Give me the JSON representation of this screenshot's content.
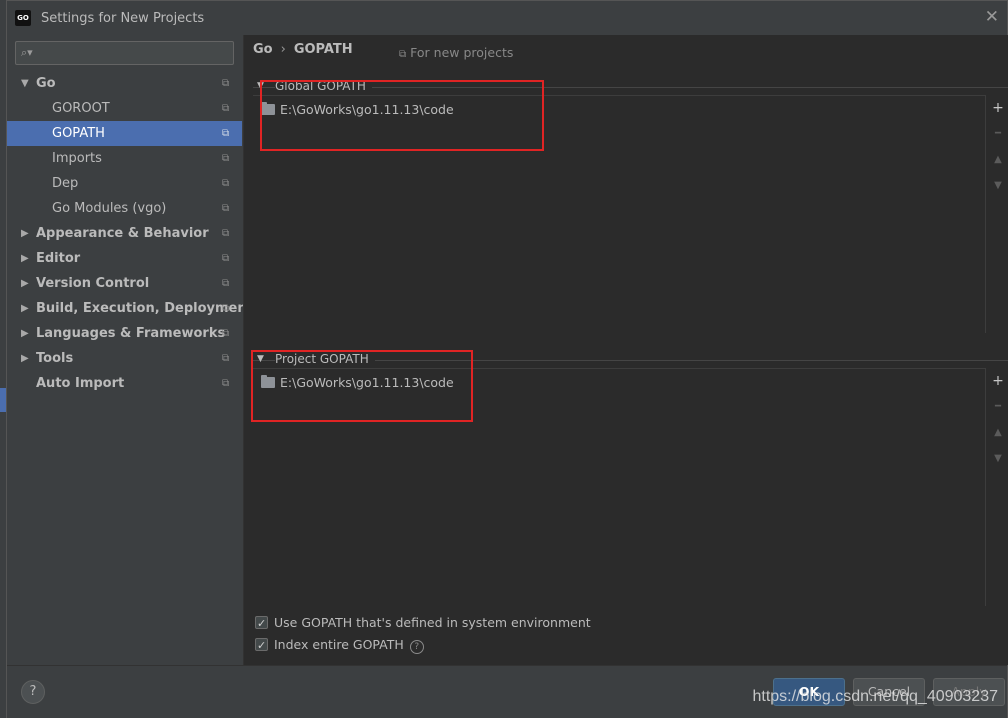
{
  "window": {
    "title": "Settings for New Projects",
    "app_icon_text": "GO"
  },
  "search": {
    "placeholder": "",
    "icon": "search-icon"
  },
  "tree": {
    "items": [
      {
        "label": "Go",
        "expanded": true,
        "bold": true,
        "level": 0
      },
      {
        "label": "GOROOT",
        "level": 1
      },
      {
        "label": "GOPATH",
        "level": 1,
        "selected": true
      },
      {
        "label": "Imports",
        "level": 1
      },
      {
        "label": "Dep",
        "level": 1
      },
      {
        "label": "Go Modules (vgo)",
        "level": 1
      },
      {
        "label": "Appearance & Behavior",
        "bold": true,
        "level": 0
      },
      {
        "label": "Editor",
        "bold": true,
        "level": 0
      },
      {
        "label": "Version Control",
        "bold": true,
        "level": 0
      },
      {
        "label": "Build, Execution, Deployment",
        "bold": true,
        "level": 0
      },
      {
        "label": "Languages & Frameworks",
        "bold": true,
        "level": 0
      },
      {
        "label": "Tools",
        "bold": true,
        "level": 0
      },
      {
        "label": "Auto Import",
        "bold": true,
        "level": 0
      }
    ]
  },
  "breadcrumb": {
    "parent": "Go",
    "separator": "›",
    "current": "GOPATH"
  },
  "scope_note": "For new projects",
  "global_gopath": {
    "title": "Global GOPATH",
    "paths": [
      "E:\\GoWorks\\go1.11.13\\code"
    ]
  },
  "project_gopath": {
    "title": "Project GOPATH",
    "paths": [
      "E:\\GoWorks\\go1.11.13\\code"
    ]
  },
  "options": {
    "use_system_gopath": {
      "label": "Use GOPATH that's defined in system environment",
      "checked": true
    },
    "index_entire_gopath": {
      "label": "Index entire GOPATH",
      "checked": true
    }
  },
  "buttons": {
    "ok": "OK",
    "cancel": "Cancel",
    "apply": "Apply",
    "help": "?"
  },
  "watermark": "https://blog.csdn.net/qq_40903237",
  "colors": {
    "selection": "#4b6eaf",
    "annotation_box": "#e02424",
    "ok_button": "#365880"
  }
}
